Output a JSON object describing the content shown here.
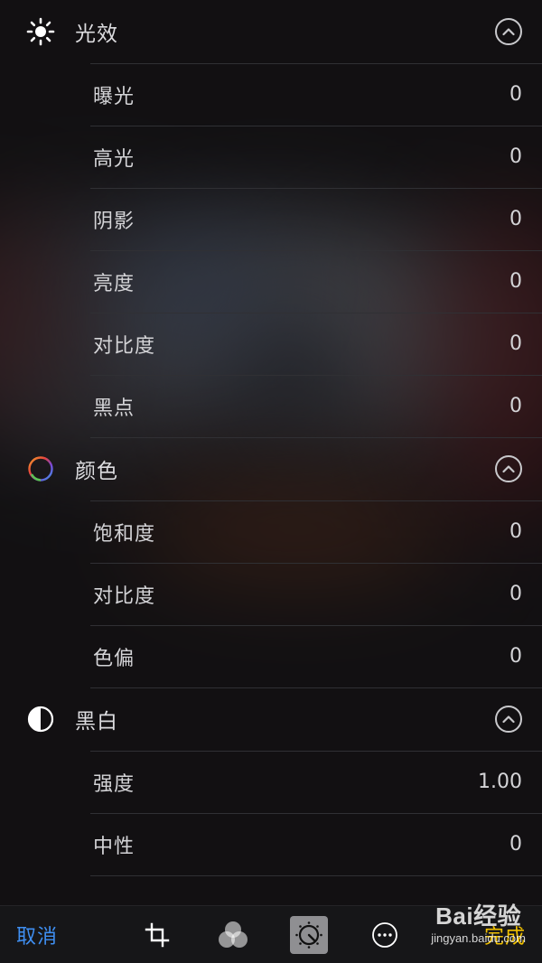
{
  "colors": {
    "background": "#121113",
    "accent_cancel": "#3f8ff2",
    "accent_done": "#f0c000",
    "separator": "#303034"
  },
  "sections": [
    {
      "title": "光效",
      "icon": "sun-icon",
      "rows": [
        {
          "label": "曝光",
          "value": "0"
        },
        {
          "label": "高光",
          "value": "0"
        },
        {
          "label": "阴影",
          "value": "0"
        },
        {
          "label": "亮度",
          "value": "0"
        },
        {
          "label": "对比度",
          "value": "0"
        },
        {
          "label": "黑点",
          "value": "0"
        }
      ]
    },
    {
      "title": "颜色",
      "icon": "color-ring-icon",
      "rows": [
        {
          "label": "饱和度",
          "value": "0"
        },
        {
          "label": "对比度",
          "value": "0"
        },
        {
          "label": "色偏",
          "value": "0"
        }
      ]
    },
    {
      "title": "黑白",
      "icon": "half-circle-icon",
      "rows": [
        {
          "label": "强度",
          "value": "1.00"
        },
        {
          "label": "中性",
          "value": "0"
        }
      ]
    }
  ],
  "toolbar": {
    "cancel_label": "取消",
    "done_label": "完成",
    "tools": [
      "crop-icon",
      "filters-icon",
      "adjust-icon",
      "more-icon"
    ]
  },
  "watermark": {
    "brand": "Bai经验",
    "url": "jingyan.baidu.com"
  }
}
